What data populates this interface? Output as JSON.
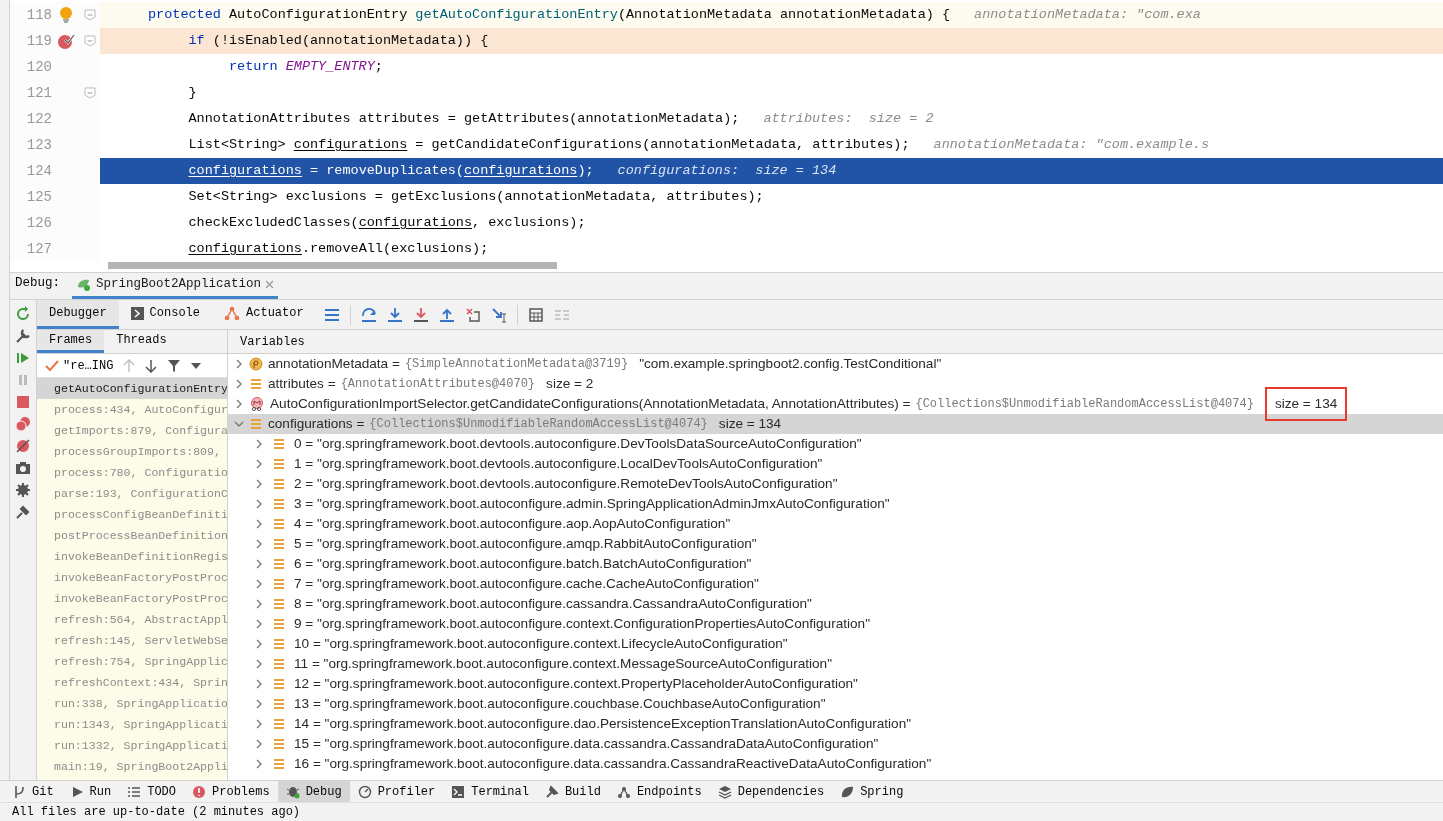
{
  "editor": {
    "lines": [
      {
        "number": "118",
        "kind": "caret",
        "fold": true,
        "tokens": [
          {
            "kind": "kw",
            "s": "protected"
          },
          {
            "kind": "text",
            "s": " AutoConfigurationEntry "
          },
          {
            "kind": "method",
            "s": "getAutoConfigurationEntry"
          },
          {
            "kind": "text",
            "s": "(AnnotationMetadata annotationMetadata) {"
          },
          {
            "kind": "hint",
            "s": "annotationMetadata: \"com.exa"
          }
        ],
        "children": [
          {
            "number": "119",
            "kind": "breakpoint",
            "fold": true,
            "tokens": [
              {
                "kind": "kw",
                "s": "if"
              },
              {
                "kind": "text",
                "s": " (!isEnabled(annotationMetadata)) {"
              }
            ],
            "children": [
              {
                "number": "120",
                "kind": "normal",
                "fold": false,
                "tokens": [
                  {
                    "kind": "kw",
                    "s": "return"
                  },
                  {
                    "kind": "const",
                    "s": "EMPTY_ENTRY"
                  },
                  {
                    "kind": "text",
                    "s": ";"
                  }
                ]
              }
            ]
          },
          {
            "number": "121",
            "kind": "normal",
            "fold": true,
            "tokens": [
              {
                "kind": "text",
                "s": "}"
              }
            ]
          },
          {
            "number": "122",
            "kind": "normal",
            "fold": false,
            "tokens": [
              {
                "kind": "text",
                "s": "AnnotationAttributes attributes = getAttributes(annotationMetadata);"
              },
              {
                "kind": "hint",
                "s": "attributes:  size = 2"
              }
            ]
          },
          {
            "number": "123",
            "kind": "normal",
            "fold": false,
            "tokens": [
              {
                "kind": "text",
                "s": "List<String> "
              },
              {
                "kind": "var",
                "s": "configurations"
              },
              {
                "kind": "text",
                "s": " = getCandidateConfigurations(annotationMetadata, attributes);"
              },
              {
                "kind": "hint",
                "s": "annotationMetadata: \"com.example.s"
              }
            ]
          },
          {
            "number": "124",
            "kind": "execution",
            "fold": false,
            "tokens": [
              {
                "kind": "var",
                "s": "configurations"
              },
              {
                "kind": "text",
                "s": " = removeDuplicates("
              },
              {
                "kind": "var",
                "s": "configurations"
              },
              {
                "kind": "text",
                "s": ");"
              },
              {
                "kind": "hint",
                "s": "configurations:  size = 134"
              }
            ]
          },
          {
            "number": "125",
            "kind": "normal",
            "fold": false,
            "tokens": [
              {
                "kind": "text",
                "s": "Set<String> exclusions = getExclusions(annotationMetadata, attributes);"
              }
            ]
          },
          {
            "number": "126",
            "kind": "normal",
            "fold": false,
            "tokens": [
              {
                "kind": "text",
                "s": "checkExcludedClasses("
              },
              {
                "kind": "var",
                "s": "configurations"
              },
              {
                "kind": "text",
                "s": ", exclusions);"
              }
            ]
          },
          {
            "number": "127",
            "kind": "normal",
            "fold": false,
            "tokens": [
              {
                "kind": "var",
                "s": "configurations"
              },
              {
                "kind": "text",
                "s": ".removeAll(exclusions);"
              }
            ]
          }
        ]
      }
    ]
  },
  "debug": {
    "label": "Debug:",
    "session": "SpringBoot2Application",
    "tabs": [
      {
        "label": "Debugger",
        "kind": "plain",
        "selected": true
      },
      {
        "label": "Console",
        "kind": "console",
        "selected": false
      },
      {
        "label": "Actuator",
        "kind": "actuator",
        "selected": false
      }
    ],
    "frame_tabs": [
      {
        "label": "Frames",
        "selected": true
      },
      {
        "label": "Threads",
        "selected": false
      }
    ],
    "thread": "\"re…ING",
    "frames": [
      {
        "text": "getAutoConfigurationEntry",
        "selected": true
      },
      {
        "text": "process:434, AutoConfigur",
        "selected": false
      },
      {
        "text": "getImports:879, Configura",
        "selected": false
      },
      {
        "text": "processGroupImports:809,",
        "selected": false
      },
      {
        "text": "process:780, Configuratio",
        "selected": false
      },
      {
        "text": "parse:193, ConfigurationC",
        "selected": false
      },
      {
        "text": "processConfigBeanDefiniti",
        "selected": false
      },
      {
        "text": "postProcessBeanDefinition",
        "selected": false
      },
      {
        "text": "invokeBeanDefinitionRegis",
        "selected": false
      },
      {
        "text": "invokeBeanFactoryPostProc",
        "selected": false
      },
      {
        "text": "invokeBeanFactoryPostProc",
        "selected": false
      },
      {
        "text": "refresh:564, AbstractAppl",
        "selected": false
      },
      {
        "text": "refresh:145, ServletWebSe",
        "selected": false
      },
      {
        "text": "refresh:754, SpringApplic",
        "selected": false
      },
      {
        "text": "refreshContext:434, Sprin",
        "selected": false
      },
      {
        "text": "run:338, SpringApplicatio",
        "selected": false
      },
      {
        "text": "run:1343, SpringApplicati",
        "selected": false
      },
      {
        "text": "run:1332, SpringApplicati",
        "selected": false
      },
      {
        "text": "main:19, SpringBoot2Appli",
        "selected": false
      }
    ],
    "variables_header": "Variables",
    "variables": [
      {
        "kind": "parameter",
        "name": "annotationMetadata =",
        "ref": "{SimpleAnnotationMetadata@3719}",
        "value": "\"com.example.springboot2.config.TestConditional\"",
        "expanded": false,
        "selected": false,
        "boxed": false
      },
      {
        "kind": "list",
        "name": "attributes =",
        "ref": "{AnnotationAttributes@4070}",
        "value": "size = 2",
        "expanded": false,
        "selected": false,
        "boxed": false
      },
      {
        "kind": "method",
        "name": "AutoConfigurationImportSelector.getCandidateConfigurations(AnnotationMetadata, AnnotationAttributes) =",
        "ref": "{Collections$UnmodifiableRandomAccessList@4074}",
        "value": "size = 134",
        "expanded": false,
        "selected": false,
        "boxed": true
      },
      {
        "kind": "list",
        "name": "configurations =",
        "ref": "{Collections$UnmodifiableRandomAccessList@4074}",
        "value": "size = 134",
        "expanded": true,
        "selected": true,
        "boxed": false,
        "children": [
          {
            "text": "0 = \"org.springframework.boot.devtools.autoconfigure.DevToolsDataSourceAutoConfiguration\""
          },
          {
            "text": "1 = \"org.springframework.boot.devtools.autoconfigure.LocalDevToolsAutoConfiguration\""
          },
          {
            "text": "2 = \"org.springframework.boot.devtools.autoconfigure.RemoteDevToolsAutoConfiguration\""
          },
          {
            "text": "3 = \"org.springframework.boot.autoconfigure.admin.SpringApplicationAdminJmxAutoConfiguration\""
          },
          {
            "text": "4 = \"org.springframework.boot.autoconfigure.aop.AopAutoConfiguration\""
          },
          {
            "text": "5 = \"org.springframework.boot.autoconfigure.amqp.RabbitAutoConfiguration\""
          },
          {
            "text": "6 = \"org.springframework.boot.autoconfigure.batch.BatchAutoConfiguration\""
          },
          {
            "text": "7 = \"org.springframework.boot.autoconfigure.cache.CacheAutoConfiguration\""
          },
          {
            "text": "8 = \"org.springframework.boot.autoconfigure.cassandra.CassandraAutoConfiguration\""
          },
          {
            "text": "9 = \"org.springframework.boot.autoconfigure.context.ConfigurationPropertiesAutoConfiguration\""
          },
          {
            "text": "10 = \"org.springframework.boot.autoconfigure.context.LifecycleAutoConfiguration\""
          },
          {
            "text": "11 = \"org.springframework.boot.autoconfigure.context.MessageSourceAutoConfiguration\""
          },
          {
            "text": "12 = \"org.springframework.boot.autoconfigure.context.PropertyPlaceholderAutoConfiguration\""
          },
          {
            "text": "13 = \"org.springframework.boot.autoconfigure.couchbase.CouchbaseAutoConfiguration\""
          },
          {
            "text": "14 = \"org.springframework.boot.autoconfigure.dao.PersistenceExceptionTranslationAutoConfiguration\""
          },
          {
            "text": "15 = \"org.springframework.boot.autoconfigure.data.cassandra.CassandraDataAutoConfiguration\""
          },
          {
            "text": "16 = \"org.springframework.boot.autoconfigure.data.cassandra.CassandraReactiveDataAutoConfiguration\""
          }
        ]
      }
    ]
  },
  "tool_tabs": [
    {
      "label": "Git",
      "kind": "git",
      "selected": false
    },
    {
      "label": "Run",
      "kind": "run",
      "selected": false
    },
    {
      "label": "TODO",
      "kind": "todo",
      "selected": false
    },
    {
      "label": "Problems",
      "kind": "problems",
      "selected": false
    },
    {
      "label": "Debug",
      "kind": "debug",
      "selected": true
    },
    {
      "label": "Profiler",
      "kind": "profiler",
      "selected": false
    },
    {
      "label": "Terminal",
      "kind": "terminal",
      "selected": false
    },
    {
      "label": "Build",
      "kind": "build",
      "selected": false
    },
    {
      "label": "Endpoints",
      "kind": "endpoints",
      "selected": false
    },
    {
      "label": "Dependencies",
      "kind": "dependencies",
      "selected": false
    },
    {
      "label": "Spring",
      "kind": "spring",
      "selected": false
    }
  ],
  "status_bar": "All files are up-to-date (2 minutes ago)"
}
